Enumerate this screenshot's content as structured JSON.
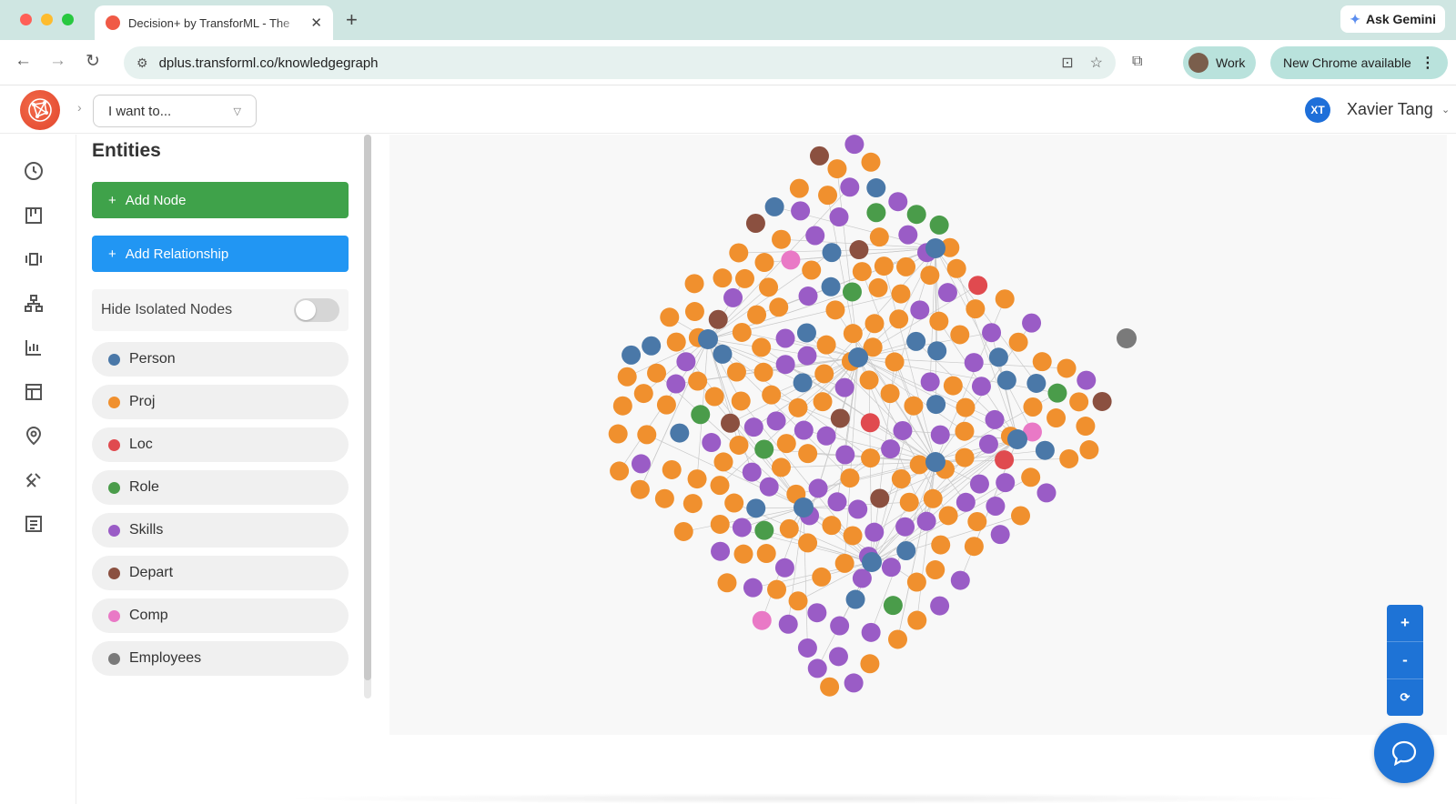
{
  "browser": {
    "tab_title": "Decision+ by TransforML - The",
    "url": "dplus.transforml.co/knowledgegraph",
    "ask_gemini": "Ask Gemini",
    "profile_label": "Work",
    "update_label": "New Chrome available"
  },
  "header": {
    "intent_placeholder": "I want to...",
    "user_initials": "XT",
    "user_name": "Xavier Tang"
  },
  "rail": {
    "icons": [
      "history-icon",
      "board-icon",
      "carousel-icon",
      "hierarchy-icon",
      "bar-chart-icon",
      "table-layout-icon",
      "location-icon",
      "tools-icon",
      "list-icon"
    ]
  },
  "panel": {
    "title": "Entities",
    "add_node": "Add Node",
    "add_relationship": "Add Relationship",
    "hide_isolated": "Hide Isolated Nodes",
    "hide_isolated_on": false,
    "entities": [
      {
        "label": "Person",
        "color": "#4a78a8"
      },
      {
        "label": "Proj",
        "color": "#f0902e"
      },
      {
        "label": "Loc",
        "color": "#e04a4f"
      },
      {
        "label": "Role",
        "color": "#4a9c4a"
      },
      {
        "label": "Skills",
        "color": "#9a5cc6"
      },
      {
        "label": "Depart",
        "color": "#8b5040"
      },
      {
        "label": "Comp",
        "color": "#e979c6"
      },
      {
        "label": "Employees",
        "color": "#7a7a7a"
      }
    ]
  },
  "graph": {
    "zoom_in": "+",
    "zoom_out": "-",
    "reset": "⟳"
  }
}
